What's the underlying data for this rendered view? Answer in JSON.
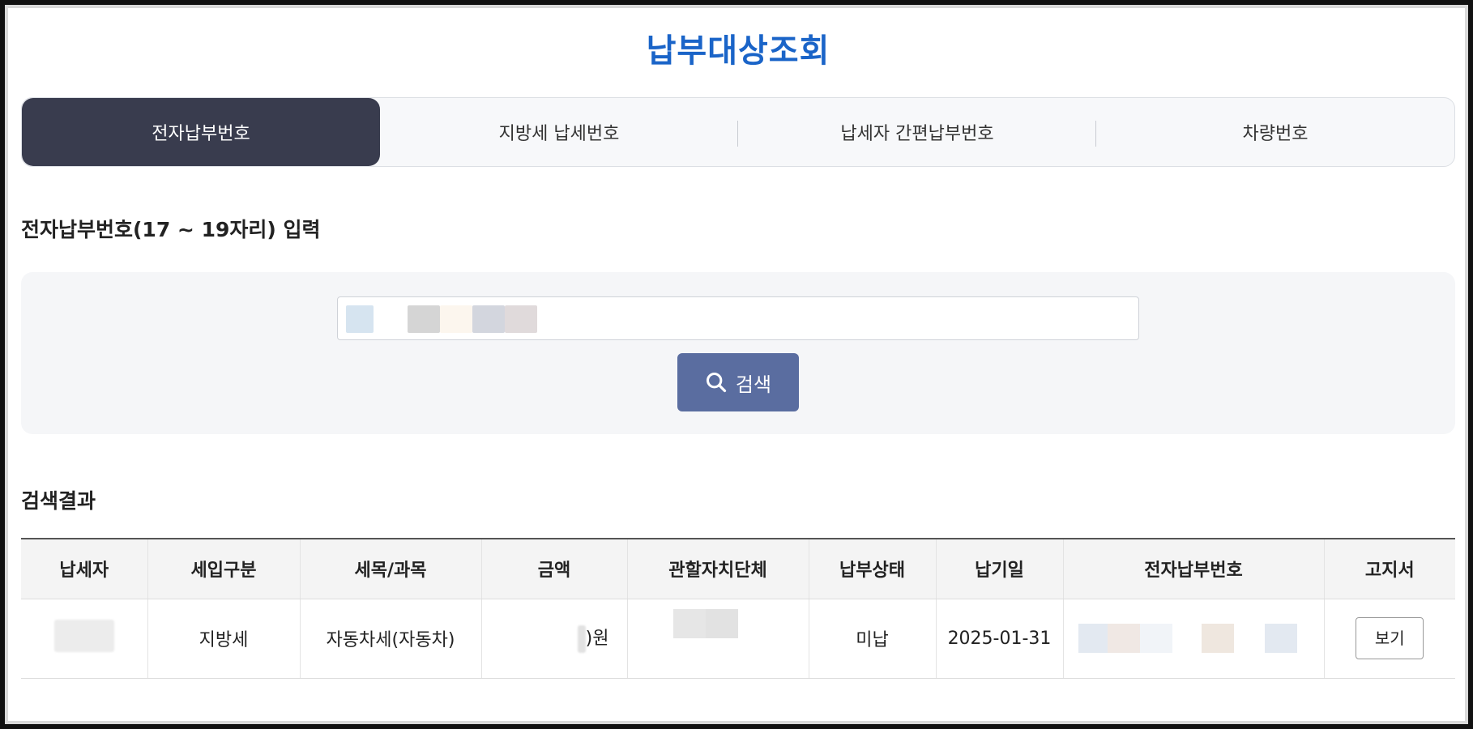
{
  "page": {
    "title": "납부대상조회"
  },
  "tabs": [
    {
      "label": "전자납부번호",
      "active": true
    },
    {
      "label": "지방세 납세번호",
      "active": false
    },
    {
      "label": "납세자 간편납부번호",
      "active": false
    },
    {
      "label": "차량번호",
      "active": false
    }
  ],
  "search": {
    "section_title": "전자납부번호(17 ~ 19자리) 입력",
    "input_value": "",
    "button_label": "검색",
    "button_icon": "search-icon"
  },
  "results": {
    "section_title": "검색결과",
    "columns": [
      "납세자",
      "세입구분",
      "세목/과목",
      "금액",
      "관할자치단체",
      "납부상태",
      "납기일",
      "전자납부번호",
      "고지서"
    ],
    "rows": [
      {
        "taxpayer": "",
        "revenue_type": "지방세",
        "tax_item": "자동차세(자동차)",
        "amount": ")원",
        "jurisdiction": "",
        "payment_status": "미납",
        "due_date": "2025-01-31",
        "payment_number": "",
        "notice_button": "보기"
      }
    ]
  },
  "colors": {
    "title": "#1a64c8",
    "active_tab": "#393c4e",
    "search_button": "#5a6da0"
  }
}
